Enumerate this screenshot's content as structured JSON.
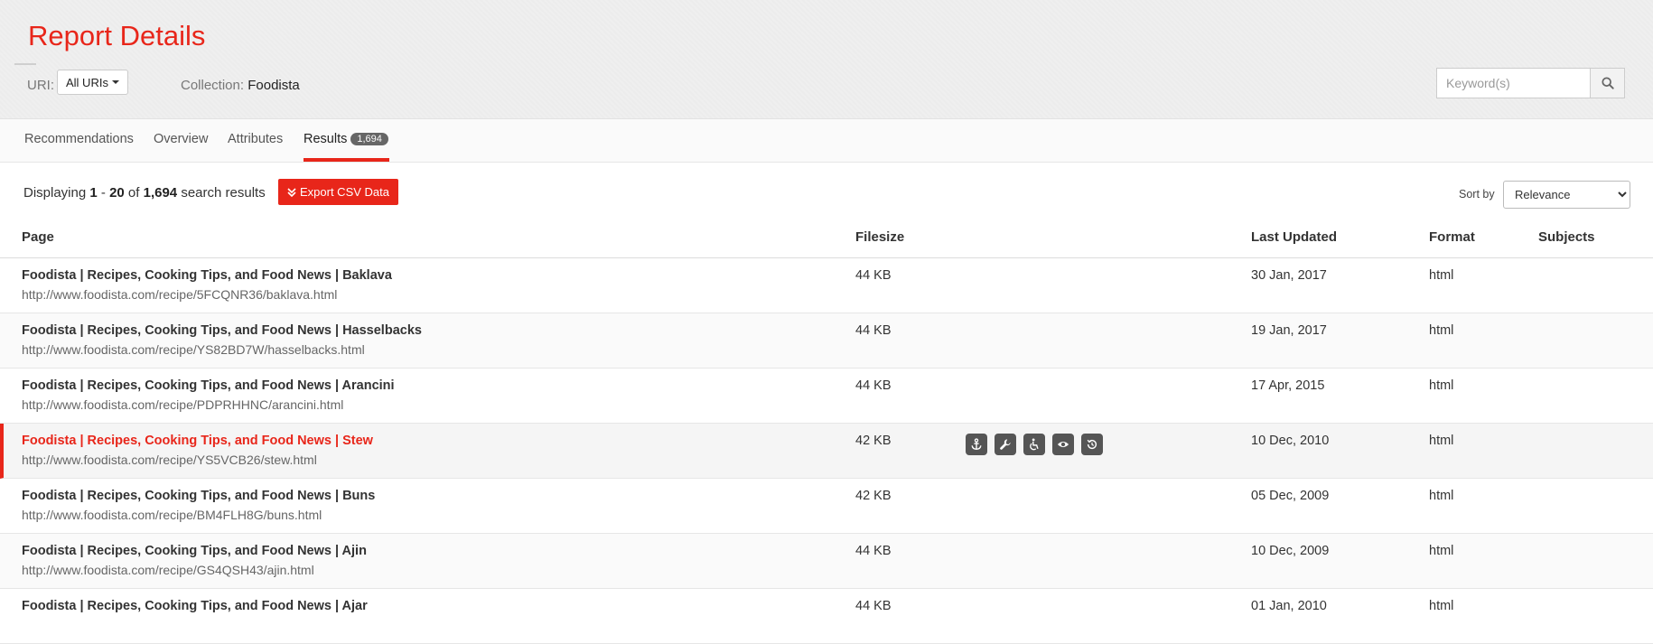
{
  "header": {
    "title": "Report Details",
    "uri_label": "URI:",
    "uri_value": "All URIs",
    "collection_label": "Collection:",
    "collection_value": "Foodista",
    "search_placeholder": "Keyword(s)"
  },
  "tabs": [
    {
      "label": "Recommendations"
    },
    {
      "label": "Overview"
    },
    {
      "label": "Attributes"
    },
    {
      "label": "Results",
      "badge": "1,694",
      "active": true
    }
  ],
  "toolbar": {
    "displaying_prefix": "Displaying",
    "range_start": "1",
    "range_sep": "-",
    "range_end": "20",
    "of": "of",
    "total": "1,694",
    "suffix": "search results",
    "export_label": "Export CSV Data",
    "sort_label": "Sort by",
    "sort_value": "Relevance"
  },
  "columns": {
    "page": "Page",
    "filesize": "Filesize",
    "last_updated": "Last Updated",
    "format": "Format",
    "subjects": "Subjects"
  },
  "rows": [
    {
      "title": "Foodista | Recipes, Cooking Tips, and Food News | Baklava",
      "url": "http://www.foodista.com/recipe/5FCQNR36/baklava.html",
      "filesize": "44 KB",
      "updated": "30 Jan, 2017",
      "format": "html"
    },
    {
      "title": "Foodista | Recipes, Cooking Tips, and Food News | Hasselbacks",
      "url": "http://www.foodista.com/recipe/YS82BD7W/hasselbacks.html",
      "filesize": "44 KB",
      "updated": "19 Jan, 2017",
      "format": "html"
    },
    {
      "title": "Foodista | Recipes, Cooking Tips, and Food News | Arancini",
      "url": "http://www.foodista.com/recipe/PDPRHHNC/arancini.html",
      "filesize": "44 KB",
      "updated": "17 Apr, 2015",
      "format": "html"
    },
    {
      "title": "Foodista | Recipes, Cooking Tips, and Food News | Stew",
      "url": "http://www.foodista.com/recipe/YS5VCB26/stew.html",
      "filesize": "42 KB",
      "updated": "10 Dec, 2010",
      "format": "html",
      "highlight": true
    },
    {
      "title": "Foodista | Recipes, Cooking Tips, and Food News | Buns",
      "url": "http://www.foodista.com/recipe/BM4FLH8G/buns.html",
      "filesize": "42 KB",
      "updated": "05 Dec, 2009",
      "format": "html"
    },
    {
      "title": "Foodista | Recipes, Cooking Tips, and Food News | Ajin",
      "url": "http://www.foodista.com/recipe/GS4QSH43/ajin.html",
      "filesize": "44 KB",
      "updated": "10 Dec, 2009",
      "format": "html"
    },
    {
      "title": "Foodista | Recipes, Cooking Tips, and Food News | Ajar",
      "url": "",
      "filesize": "44 KB",
      "updated": "01 Jan, 2010",
      "format": "html"
    }
  ],
  "row_actions": [
    "anchor-icon",
    "wrench-icon",
    "accessibility-icon",
    "eye-icon",
    "history-icon"
  ],
  "colors": {
    "accent": "#e8261a",
    "badge": "#666666",
    "action_bg": "#555555"
  }
}
